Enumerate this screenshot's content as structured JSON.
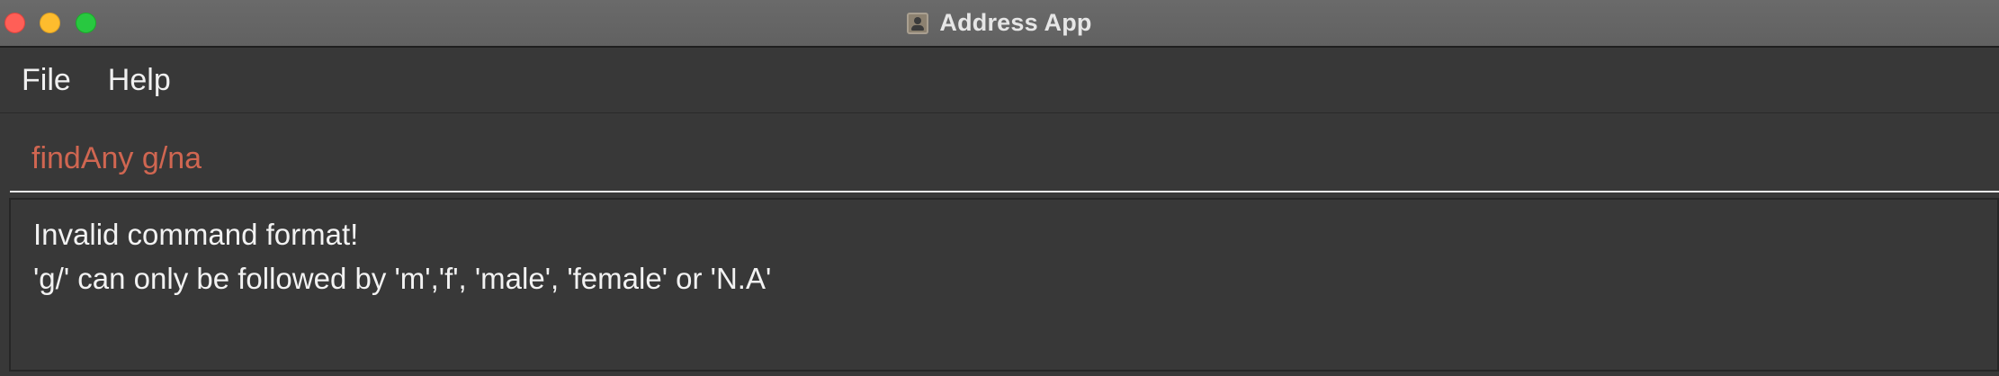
{
  "window": {
    "title": "Address App",
    "title_icon": "contact-card-icon"
  },
  "menu": {
    "items": [
      {
        "label": "File"
      },
      {
        "label": "Help"
      }
    ]
  },
  "command": {
    "value": "findAny g/na",
    "error_color": "#d06651"
  },
  "result": {
    "lines": [
      "Invalid command format!",
      "'g/' can only be followed by 'm','f', 'male', 'female' or 'N.A'"
    ]
  },
  "colors": {
    "close": "#ff5f57",
    "minimize": "#febc2e",
    "maximize": "#28c840",
    "background": "#383838"
  }
}
